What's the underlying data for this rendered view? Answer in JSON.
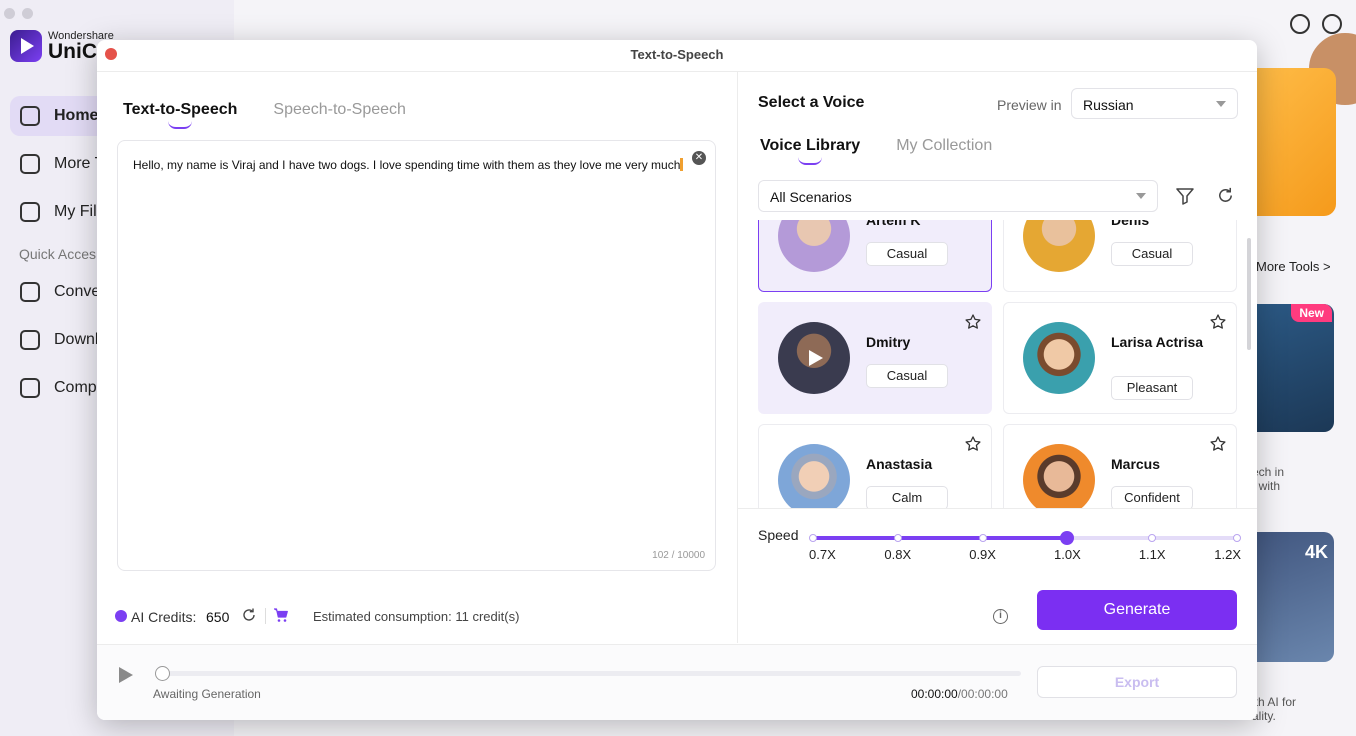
{
  "background": {
    "brand_small": "Wondershare",
    "brand_big": "UniCo",
    "nav": [
      {
        "label": "Home"
      },
      {
        "label": "More T"
      },
      {
        "label": "My Fil"
      },
      {
        "label": "Conve"
      },
      {
        "label": "Downl"
      },
      {
        "label": "Comp"
      }
    ],
    "quick_access": "Quick Acces",
    "more_tools": "More Tools >",
    "new_badge": "New",
    "card_text_1": "ech in\n, with",
    "tag_4k": "4K",
    "card_text_2": "ith AI for\nality."
  },
  "dialog": {
    "title": "Text-to-Speech",
    "tabs": [
      {
        "label": "Text-to-Speech",
        "active": true
      },
      {
        "label": "Speech-to-Speech",
        "active": false
      }
    ],
    "text": "Hello, my name is Viraj and I have two dogs. I love spending time with them as they love me very much",
    "char_count": "102 / 10000",
    "select_voice": "Select a Voice",
    "preview_in": "Preview in",
    "language": "Russian",
    "voice_tabs": [
      {
        "label": "Voice Library",
        "active": true
      },
      {
        "label": "My Collection",
        "active": false
      }
    ],
    "scenario": "All Scenarios",
    "voices": [
      {
        "name": "Artem K",
        "tag": "Casual",
        "state": "selected"
      },
      {
        "name": "Denis",
        "tag": "Casual",
        "state": "normal"
      },
      {
        "name": "Dmitry",
        "tag": "Casual",
        "state": "hover"
      },
      {
        "name": "Larisa Actrisa",
        "tag": "Pleasant",
        "state": "normal"
      },
      {
        "name": "Anastasia",
        "tag": "Calm",
        "state": "normal"
      },
      {
        "name": "Marcus",
        "tag": "Confident",
        "state": "normal"
      }
    ],
    "speed": {
      "label": "Speed",
      "options": [
        "0.7X",
        "0.8X",
        "0.9X",
        "1.0X",
        "1.1X",
        "1.2X"
      ],
      "selected_index": 3
    },
    "credits_label": "AI Credits:",
    "credits_value": "650",
    "estimated": "Estimated consumption: 11 credit(s)",
    "generate": "Generate",
    "awaiting": "Awaiting Generation",
    "time_current": "00:00:00",
    "time_total": "/00:00:00",
    "export": "Export",
    "colors": {
      "accent": "#7b2ff2",
      "selected_bg": "#f1edfb"
    }
  }
}
